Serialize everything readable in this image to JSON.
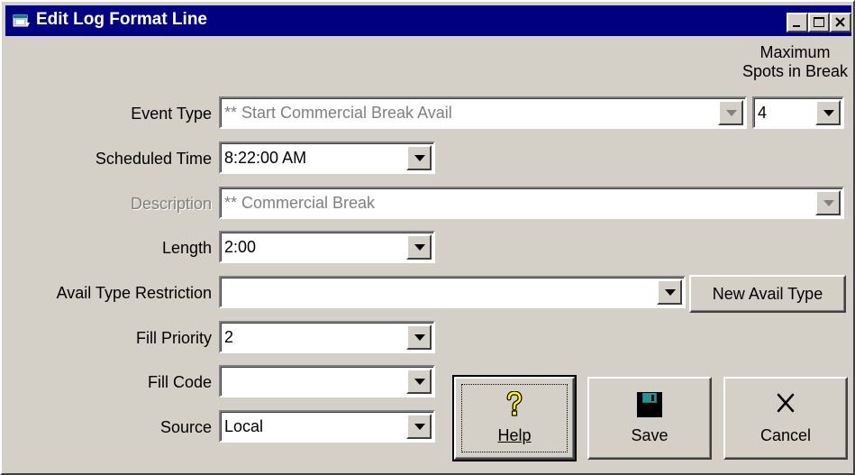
{
  "window": {
    "title": "Edit Log Format Line"
  },
  "header": {
    "max_spots_line1": "Maximum",
    "max_spots_line2": "Spots in Break"
  },
  "fields": {
    "event_type": {
      "label": "Event Type",
      "value": "** Start Commercial Break Avail",
      "enabled": false
    },
    "max_spots": {
      "value": "4"
    },
    "scheduled_time": {
      "label": "Scheduled Time",
      "value": "8:22:00 AM"
    },
    "description": {
      "label": "Description",
      "value": "** Commercial Break",
      "enabled": false
    },
    "length": {
      "label": "Length",
      "value": "2:00"
    },
    "avail_type_restriction": {
      "label": "Avail Type Restriction",
      "value": ""
    },
    "fill_priority": {
      "label": "Fill Priority",
      "value": "2"
    },
    "fill_code": {
      "label": "Fill Code",
      "value": ""
    },
    "source": {
      "label": "Source",
      "value": "Local"
    }
  },
  "buttons": {
    "new_avail_type": "New Avail Type",
    "help": "Help",
    "save": "Save",
    "cancel": "Cancel"
  },
  "icons": {
    "app": "app-window-icon",
    "minimize": "minimize-icon",
    "maximize": "maximize-icon",
    "close": "close-icon",
    "help": "question-mark-icon",
    "save": "floppy-disk-icon",
    "cancel": "x-icon"
  },
  "colors": {
    "titlebar": "#000080",
    "face": "#d4d0c8",
    "disabled_text": "#808080",
    "help_icon": "#ffff00"
  }
}
